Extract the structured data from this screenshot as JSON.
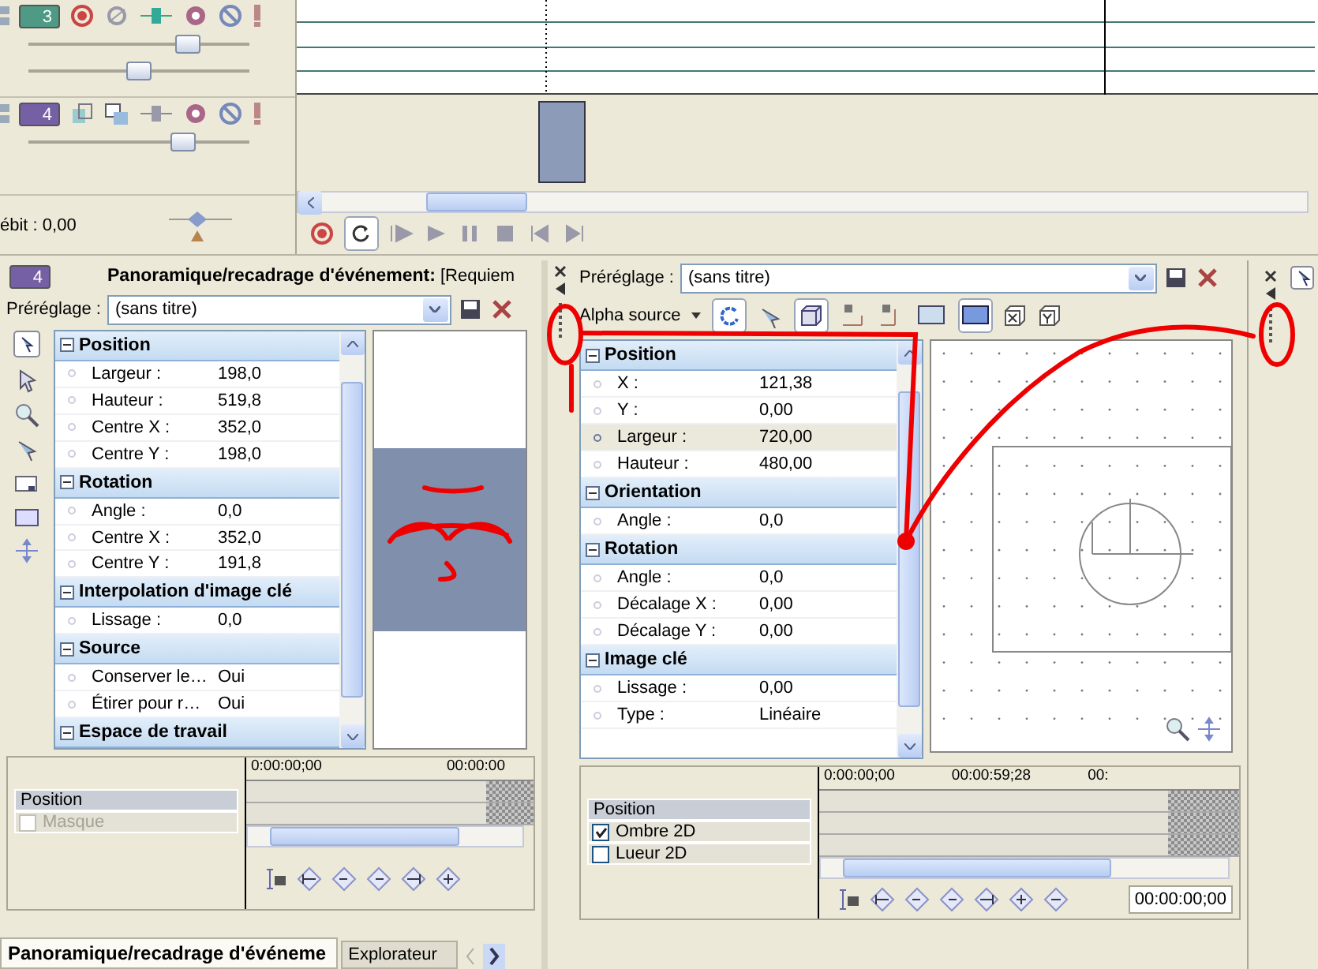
{
  "tracks": [
    {
      "number": "3",
      "color": "#4f9a84",
      "sliders": [
        {
          "level": 0.72
        },
        {
          "level": 0.5
        }
      ]
    },
    {
      "number": "4",
      "color": "#7560a6",
      "sliders": [
        {
          "level": 0.7
        }
      ]
    }
  ],
  "rate_label": "ébit : 0,00",
  "left_panel": {
    "track_number": "4",
    "title": "Panoramique/recadrage d'événement:",
    "title_suffix": "[Requiem",
    "preset_label": "Préréglage :",
    "preset_value": "(sans titre)",
    "groups": [
      {
        "name": "Position",
        "rows": [
          {
            "label": "Largeur :",
            "value": "198,0",
            "selected": false
          },
          {
            "label": "Hauteur :",
            "value": "519,8",
            "selected": false
          },
          {
            "label": "Centre X :",
            "value": "352,0",
            "selected": false
          },
          {
            "label": "Centre Y :",
            "value": "198,0",
            "selected": false
          }
        ]
      },
      {
        "name": "Rotation",
        "rows": [
          {
            "label": "Angle :",
            "value": "0,0",
            "selected": false
          },
          {
            "label": "Centre X :",
            "value": "352,0",
            "selected": false
          },
          {
            "label": "Centre Y :",
            "value": "191,8",
            "selected": false
          }
        ]
      },
      {
        "name": "Interpolation d'image clé",
        "rows": [
          {
            "label": "Lissage :",
            "value": "0,0",
            "selected": false
          }
        ]
      },
      {
        "name": "Source",
        "rows": [
          {
            "label": "Conserver le…",
            "value": "Oui",
            "selected": false
          },
          {
            "label": "Étirer pour r…",
            "value": "Oui",
            "selected": false
          }
        ]
      },
      {
        "name": "Espace de travail"
      }
    ],
    "keyframes": {
      "rows": [
        {
          "kind": "header",
          "label": "Position"
        },
        {
          "kind": "check",
          "label": "Masque",
          "checked": false,
          "disabled": true
        }
      ],
      "times": [
        "0:00:00;00",
        "00:00:00"
      ]
    }
  },
  "middle_panel": {
    "preset_label": "Préréglage :",
    "preset_value": "(sans titre)",
    "alpha_label": "Alpha source",
    "groups": [
      {
        "name": "Position",
        "rows": [
          {
            "label": "X :",
            "value": "121,38",
            "selected": false
          },
          {
            "label": "Y :",
            "value": "0,00",
            "selected": false
          },
          {
            "label": "Largeur :",
            "value": "720,00",
            "selected": true
          },
          {
            "label": "Hauteur :",
            "value": "480,00",
            "selected": false
          }
        ]
      },
      {
        "name": "Orientation",
        "rows": [
          {
            "label": "Angle :",
            "value": "0,0",
            "selected": false
          }
        ]
      },
      {
        "name": "Rotation",
        "rows": [
          {
            "label": "Angle :",
            "value": "0,0",
            "selected": false
          },
          {
            "label": "Décalage X :",
            "value": "0,00",
            "selected": false
          },
          {
            "label": "Décalage Y :",
            "value": "0,00",
            "selected": false
          }
        ]
      },
      {
        "name": "Image clé",
        "rows": [
          {
            "label": "Lissage :",
            "value": "0,00",
            "selected": false
          },
          {
            "label": "Type :",
            "value": "Linéaire",
            "selected": false
          }
        ]
      }
    ],
    "keyframes": {
      "rows": [
        {
          "kind": "header",
          "label": "Position"
        },
        {
          "kind": "check",
          "label": "Ombre 2D",
          "checked": true,
          "disabled": false
        },
        {
          "kind": "check",
          "label": "Lueur 2D",
          "checked": false,
          "disabled": false
        }
      ],
      "times": [
        "0:00:00;00",
        "00:00:59;28",
        "00:"
      ],
      "time_field": "00:00:00;00"
    }
  },
  "bottom_tabs": [
    {
      "label": "Panoramique/recadrage d'événeme",
      "selected": true
    },
    {
      "label": "Explorateur",
      "selected": false
    }
  ]
}
